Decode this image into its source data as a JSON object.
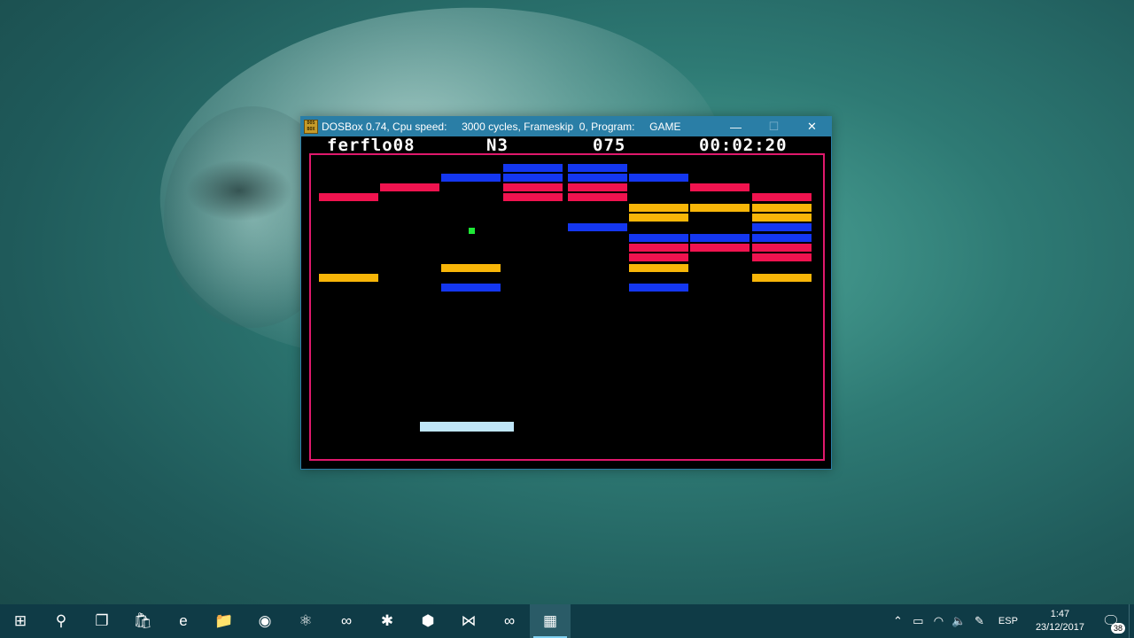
{
  "window": {
    "icon_text": "DOS BOX",
    "title": "DOSBox 0.74, Cpu speed:     3000 cycles, Frameskip  0, Program:     GAME",
    "minimize": "—",
    "maximize": "☐",
    "close": "✕"
  },
  "hud": {
    "player": "ferflo08",
    "level": "N3",
    "score": "075",
    "time": "00:02:20"
  },
  "colors": {
    "red": "#f0134f",
    "blue": "#1437f0",
    "yellow": "#f8b608",
    "border": "#e0186c",
    "ball": "#1ee836",
    "paddle": "#bfe6f8"
  },
  "taskbar": {
    "apps": [
      {
        "name": "start",
        "glyph": "⊞"
      },
      {
        "name": "search",
        "glyph": "⚲"
      },
      {
        "name": "task-view",
        "glyph": "❐"
      },
      {
        "name": "store",
        "glyph": "🛍"
      },
      {
        "name": "edge",
        "glyph": "e"
      },
      {
        "name": "file-explorer",
        "glyph": "📁"
      },
      {
        "name": "gitkraken",
        "glyph": "◉"
      },
      {
        "name": "atom",
        "glyph": "⚛"
      },
      {
        "name": "arduino",
        "glyph": "∞"
      },
      {
        "name": "electron-app",
        "glyph": "✱"
      },
      {
        "name": "virtualbox",
        "glyph": "⬢"
      },
      {
        "name": "vscode",
        "glyph": "⋈"
      },
      {
        "name": "visual-studio",
        "glyph": "∞"
      },
      {
        "name": "dosbox",
        "glyph": "▦"
      }
    ],
    "language": "ESP",
    "time": "1:47",
    "date": "23/12/2017",
    "notifications": "38"
  }
}
